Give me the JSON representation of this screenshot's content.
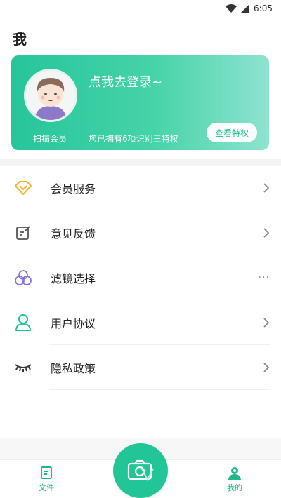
{
  "status_bar": {
    "time": "6:05",
    "icons": [
      "wifi-icon",
      "signal-icon"
    ]
  },
  "page": {
    "title": "我"
  },
  "member_card": {
    "login_prompt": "点我去登录~",
    "scan_member_label": "扫描会员",
    "privilege_text": "您已拥有6项识别王特权",
    "view_privileges_button": "查看特权"
  },
  "menu": {
    "items": [
      {
        "label": "会员服务",
        "icon": "diamond-icon",
        "trailing": "chevron-right-icon"
      },
      {
        "label": "意见反馈",
        "icon": "edit-note-icon",
        "trailing": "chevron-right-icon"
      },
      {
        "label": "滤镜选择",
        "icon": "filter-circles-icon",
        "trailing": "more-dots-icon",
        "trailing_text": "···"
      },
      {
        "label": "用户协议",
        "icon": "user-icon",
        "trailing": "chevron-right-icon"
      },
      {
        "label": "隐私政策",
        "icon": "closed-eye-icon",
        "trailing": "chevron-right-icon"
      }
    ]
  },
  "tab_bar": {
    "tabs": [
      {
        "label": "文件",
        "icon": "file-icon"
      },
      {
        "label": "我的",
        "icon": "profile-icon",
        "active": true
      }
    ],
    "center_button_icon": "camera-icon"
  },
  "colors": {
    "accent": "#21c596",
    "diamond": "#f2b21b",
    "filter": "#8b72e0",
    "user": "#21c596"
  }
}
